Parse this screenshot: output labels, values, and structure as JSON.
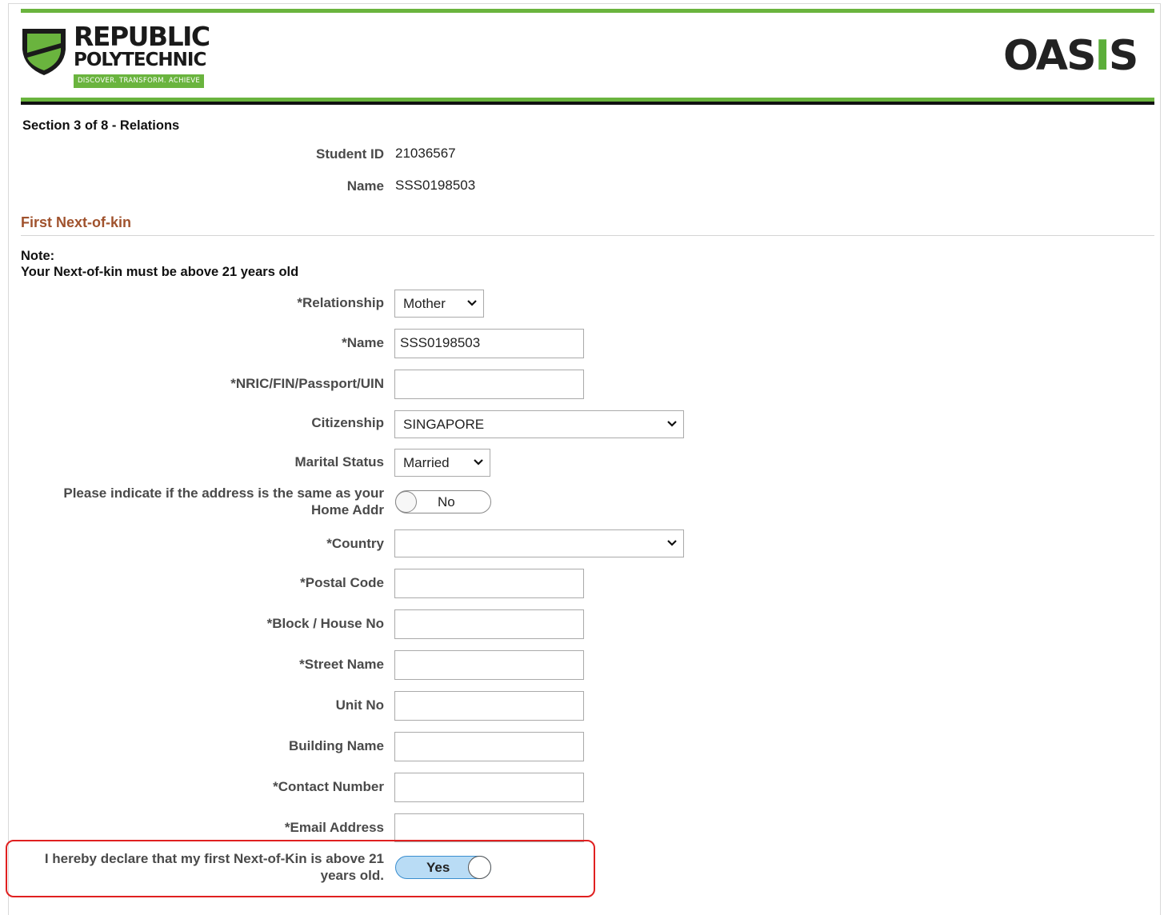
{
  "header": {
    "logo_line1": "REPUBLIC",
    "logo_line2": "POLYTECHNIC",
    "logo_tagline": "DISCOVER. TRANSFORM. ACHIEVE",
    "app_name_part1": "OA",
    "app_name_part2": "S",
    "app_name_part3": "I",
    "app_name_part4": "S"
  },
  "section_title": "Section 3 of 8 - Relations",
  "student": {
    "id_label": "Student ID",
    "id_value": "21036567",
    "name_label": "Name",
    "name_value": "SSS0198503"
  },
  "kin_heading": "First Next-of-kin",
  "note": {
    "title": "Note:",
    "text": "Your Next-of-kin must be above 21 years old"
  },
  "form": {
    "relationship_label": "*Relationship",
    "relationship_value": "Mother",
    "name_label": "*Name",
    "name_value": "SSS0198503",
    "nric_label": "*NRIC/FIN/Passport/UIN",
    "nric_value": "",
    "citizenship_label": "Citizenship",
    "citizenship_value": "SINGAPORE",
    "marital_label": "Marital Status",
    "marital_value": "Married",
    "same_addr_label": "Please indicate if the address is the same as your Home Addr",
    "same_addr_value": "No",
    "country_label": "*Country",
    "country_value": "",
    "postal_label": "*Postal Code",
    "block_label": "*Block / House No",
    "street_label": "*Street Name",
    "unit_label": "Unit No",
    "building_label": "Building Name",
    "contact_label": "*Contact Number",
    "email_label": "*Email Address",
    "declare_label": "I hereby declare that my first Next-of-Kin is above 21 years old.",
    "declare_value": "Yes"
  },
  "colors": {
    "brand_green": "#6ab43e",
    "heading_brown": "#a0522d",
    "highlight_red": "#e02020",
    "toggle_on": "#b9dcf5"
  }
}
